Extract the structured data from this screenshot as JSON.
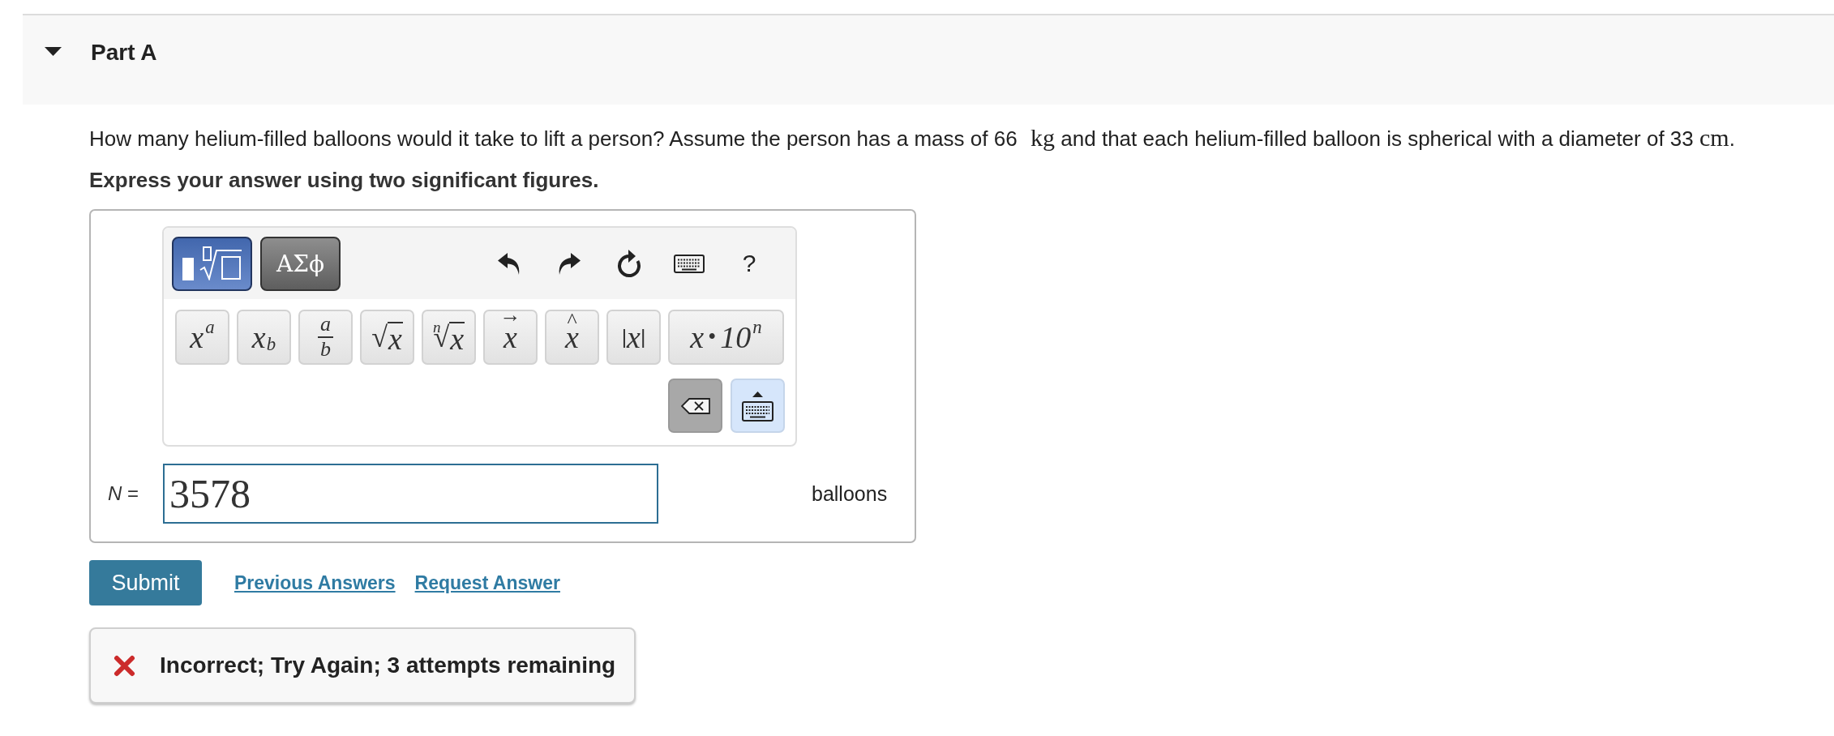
{
  "part": {
    "title": "Part A",
    "expanded": true
  },
  "question": {
    "segments": [
      {
        "kind": "text",
        "text": "How many helium-filled balloons would it take to lift a person? Assume the person has a mass of 66"
      },
      {
        "kind": "unit",
        "text": "kg"
      },
      {
        "kind": "text",
        "text": " and that each helium-filled balloon is spherical with a diameter of 33 "
      },
      {
        "kind": "unit",
        "text": "cm"
      },
      {
        "kind": "text",
        "text": "."
      }
    ]
  },
  "instruction": "Express your answer using two significant figures.",
  "toolbar": {
    "modes": [
      {
        "kind": "templates",
        "selected": true
      },
      {
        "kind": "symbols",
        "label": "ΑΣϕ",
        "selected": false
      }
    ],
    "actions": [
      {
        "kind": "undo"
      },
      {
        "kind": "redo"
      },
      {
        "kind": "reset"
      },
      {
        "kind": "keyboard"
      },
      {
        "kind": "help",
        "label": "?"
      }
    ]
  },
  "templates": [
    {
      "kind": "power",
      "base": "x",
      "script": "a"
    },
    {
      "kind": "subscript",
      "base": "x",
      "script": "b"
    },
    {
      "kind": "fraction",
      "numerator": "a",
      "denominator": "b"
    },
    {
      "kind": "root",
      "symbol": "√",
      "radicand": "x"
    },
    {
      "kind": "nthroot",
      "index": "n",
      "symbol": "√",
      "radicand": "x"
    },
    {
      "kind": "vector",
      "accent": "→",
      "base": "x"
    },
    {
      "kind": "hat",
      "accent": "^",
      "base": "x"
    },
    {
      "kind": "abs",
      "left": "|",
      "base": "x",
      "right": "|"
    },
    {
      "kind": "scientific",
      "mantissa": "x",
      "operator": "•",
      "base": "10",
      "exponent": "n"
    }
  ],
  "keypad": [
    {
      "kind": "backspace"
    },
    {
      "kind": "keyboard"
    }
  ],
  "answer": {
    "label": "*N* =",
    "value": "3578",
    "unit": "balloons"
  },
  "actions": {
    "submit": "Submit",
    "links": [
      "Previous Answers",
      "Request Answer"
    ]
  },
  "feedback": {
    "correct": false,
    "message": "Incorrect; Try Again; 3 attempts remaining"
  }
}
